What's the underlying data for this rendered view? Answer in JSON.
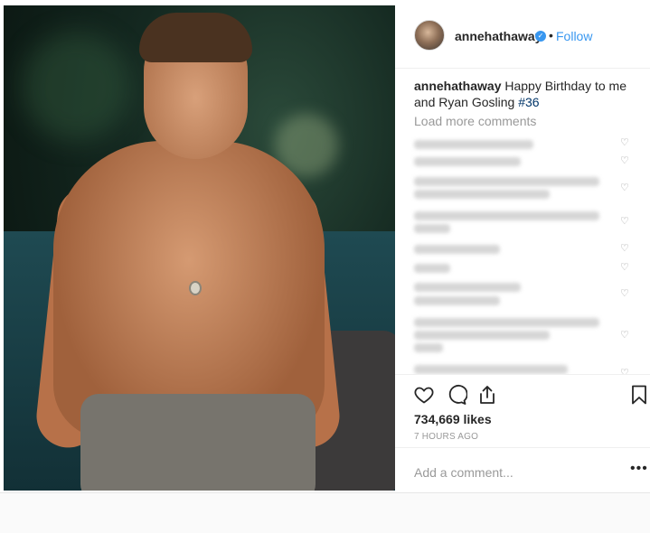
{
  "post": {
    "username": "annehathaway",
    "separator": "•",
    "follow_label": "Follow",
    "caption_user": "annehathaway",
    "caption_text": " Happy Birthday to me and Ryan Gosling ",
    "caption_hashtag": "#36",
    "load_more_label": "Load more comments",
    "likes": "734,669 likes",
    "time_ago": "7 HOURS AGO",
    "add_comment_placeholder": "Add a comment...",
    "more_options": "•••",
    "verified_icon": "✓",
    "heart_icon": "♡"
  },
  "colors": {
    "link_blue": "#3897f0",
    "verified_blue": "#3897f0",
    "muted_text": "#999999",
    "hashtag": "#003569"
  }
}
